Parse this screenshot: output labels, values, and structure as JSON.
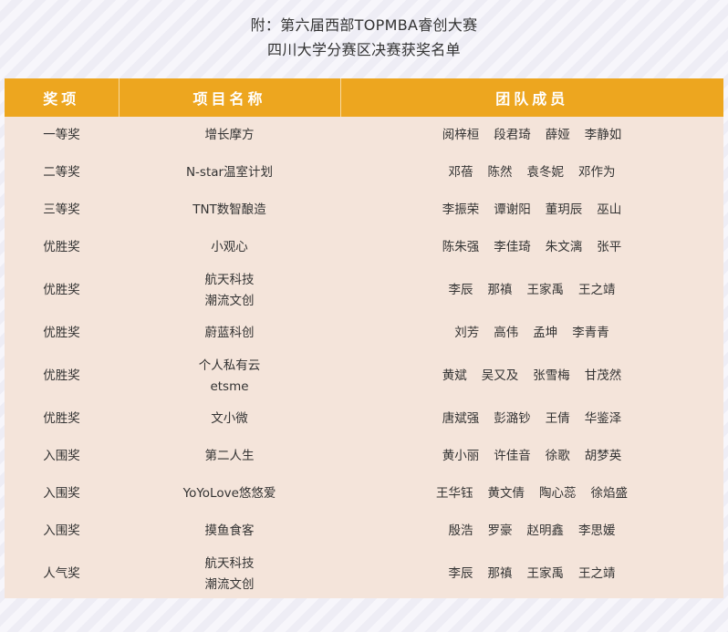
{
  "caption": {
    "line1": "附：第六届西部TOPMBA睿创大赛",
    "line2": "四川大学分赛区决赛获奖名单"
  },
  "table": {
    "headers": [
      "奖项",
      "项目名称",
      "团队成员"
    ],
    "rows": [
      {
        "award": "一等奖",
        "project": [
          "增长摩方"
        ],
        "members": [
          "阅梓桓",
          "段君琦",
          "薛娅",
          "李静如"
        ]
      },
      {
        "award": "二等奖",
        "project": [
          "N-star温室计划"
        ],
        "members": [
          "邓蓓",
          "陈然",
          "袁冬妮",
          "邓作为"
        ]
      },
      {
        "award": "三等奖",
        "project": [
          "TNT数智酿造"
        ],
        "members": [
          "李振荣",
          "谭谢阳",
          "董玥辰",
          "巫山"
        ]
      },
      {
        "award": "优胜奖",
        "project": [
          "小观心"
        ],
        "members": [
          "陈朱强",
          "李佳琦",
          "朱文漓",
          "张平"
        ]
      },
      {
        "award": "优胜奖",
        "project": [
          "航天科技",
          "潮流文创"
        ],
        "members": [
          "李辰",
          "那禛",
          "王家禹",
          "王之靖"
        ]
      },
      {
        "award": "优胜奖",
        "project": [
          "蔚蓝科创"
        ],
        "members": [
          "刘芳",
          "高伟",
          "孟坤",
          "李青青"
        ]
      },
      {
        "award": "优胜奖",
        "project": [
          "个人私有云",
          "etsme"
        ],
        "members": [
          "黄斌",
          "吴又及",
          "张雪梅",
          "甘茂然"
        ]
      },
      {
        "award": "优胜奖",
        "project": [
          "文小微"
        ],
        "members": [
          "唐斌强",
          "彭潞钞",
          "王倩",
          "华鉴泽"
        ]
      },
      {
        "award": "入围奖",
        "project": [
          "第二人生"
        ],
        "members": [
          "黄小丽",
          "许佳音",
          "徐歌",
          "胡梦英"
        ]
      },
      {
        "award": "入围奖",
        "project": [
          "YoYoLove悠悠爱"
        ],
        "members": [
          "王华钰",
          "黄文倩",
          "陶心蕊",
          "徐焰盛"
        ]
      },
      {
        "award": "入围奖",
        "project": [
          "摸鱼食客"
        ],
        "members": [
          "殷浩",
          "罗豪",
          "赵明鑫",
          "李思媛"
        ]
      },
      {
        "award": "人气奖",
        "project": [
          "航天科技",
          "潮流文创"
        ],
        "members": [
          "李辰",
          "那禛",
          "王家禹",
          "王之靖"
        ]
      }
    ]
  }
}
